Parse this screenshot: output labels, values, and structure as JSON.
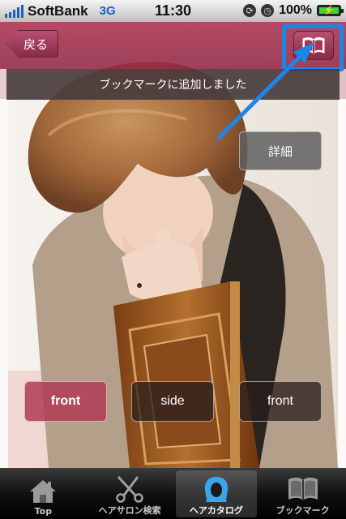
{
  "status_bar": {
    "carrier": "SoftBank",
    "network": "3G",
    "time": "11:30",
    "battery_percent": "100%"
  },
  "nav": {
    "back_label": "戻る",
    "bookmark_icon": "book-icon"
  },
  "toast": {
    "message": "ブックマークに追加しました"
  },
  "detail_button": {
    "label": "詳細"
  },
  "view_buttons": [
    {
      "label": "front",
      "selected": true
    },
    {
      "label": "side",
      "selected": false
    },
    {
      "label": "front",
      "selected": false
    }
  ],
  "tabs": [
    {
      "label": "Top",
      "icon": "home-icon",
      "active": false
    },
    {
      "label": "ヘアサロン検索",
      "icon": "scissors-icon",
      "active": false
    },
    {
      "label": "ヘアカタログ",
      "icon": "hair-icon",
      "active": true
    },
    {
      "label": "ブックマーク",
      "icon": "book-icon",
      "active": false
    }
  ],
  "colors": {
    "nav_tint": "#a8345a",
    "highlight": "#1b86e8",
    "battery": "#3bd43b"
  }
}
